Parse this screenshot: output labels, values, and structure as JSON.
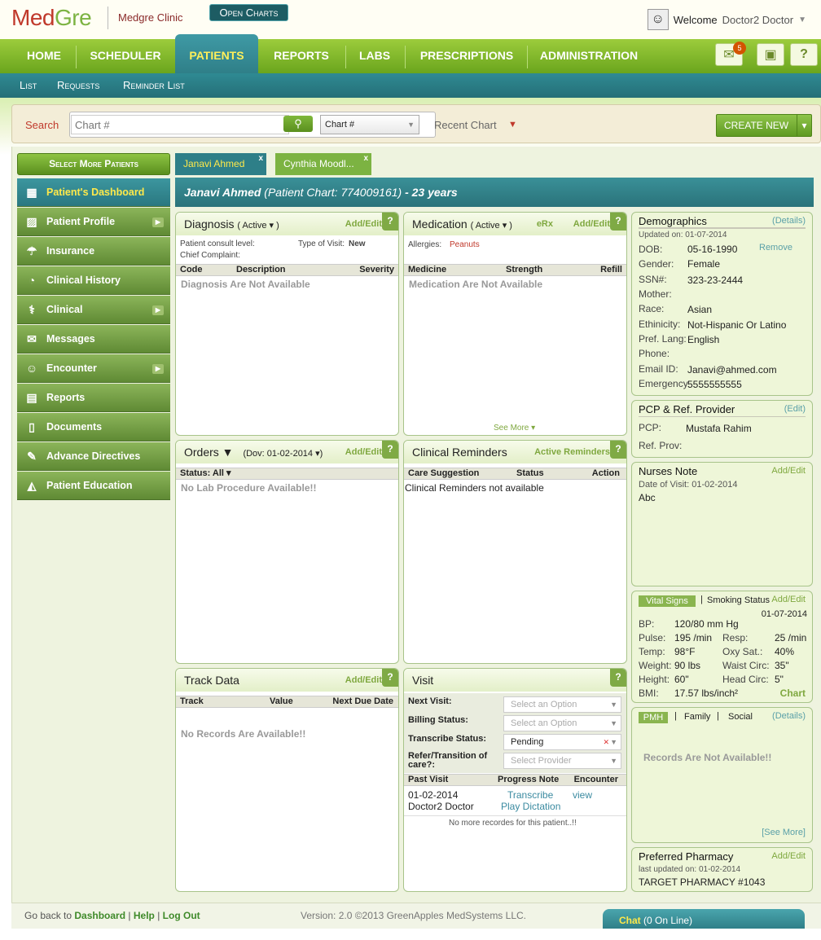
{
  "brand": {
    "logo_part1": "Med",
    "logo_part2": "Gre",
    "clinic": "Medgre Clinic"
  },
  "user": {
    "welcome": "Welcome",
    "name": "Doctor2 Doctor"
  },
  "nav": {
    "items": [
      "HOME",
      "SCHEDULER",
      "PATIENTS",
      "REPORTS",
      "LABS",
      "PRESCRIPTIONS",
      "ADMINISTRATION"
    ],
    "active": "PATIENTS",
    "mail_count": "5",
    "help": "?"
  },
  "subnav": {
    "items": [
      "List",
      "Requests",
      "Reminder List"
    ],
    "active": "Open Charts"
  },
  "search": {
    "label": "Search",
    "placeholder": "Chart #",
    "type": "Chart #",
    "recent": "Recent Chart",
    "create_new": "CREATE NEW"
  },
  "sidebar": {
    "select_more": "Select More Patients",
    "items": [
      "Patient's Dashboard",
      "Patient Profile",
      "Insurance",
      "Clinical History",
      "Clinical",
      "Messages",
      "Encounter",
      "Reports",
      "Documents",
      "Advance Directives",
      "Patient Education"
    ]
  },
  "tabs": [
    "Janavi Ahmed",
    "Cynthia Moodl..."
  ],
  "patient": {
    "name": "Janavi Ahmed",
    "chart": "(Patient Chart: 774009161)",
    "age": "- 23 years"
  },
  "diagnosis": {
    "title": "Diagnosis",
    "filter": "( Active ▾ )",
    "add_edit": "Add/Edit",
    "consult": "Patient consult level:",
    "visit_type_label": "Type of Visit:",
    "visit_type": "New",
    "complaint": "Chief Complaint:",
    "cols": [
      "Code",
      "Description",
      "Severity"
    ],
    "empty": "Diagnosis Are Not Available"
  },
  "medication": {
    "title": "Medication",
    "filter": "( Active ▾ )",
    "erx": "eRx",
    "add_edit": "Add/Edit",
    "allergies_label": "Allergies:",
    "allergies": "Peanuts",
    "cols": [
      "Medicine",
      "Strength",
      "Refill"
    ],
    "empty": "Medication Are Not Available",
    "see_more": "See More ▾"
  },
  "orders": {
    "title": "Orders ▼",
    "dov": "(Dov: 01-02-2014 ▾)",
    "add_edit": "Add/Edit",
    "status": "Status: All ▾",
    "empty": "No Lab Procedure Available!!"
  },
  "reminders": {
    "title": "Clinical Reminders",
    "link": "Active Reminders",
    "cols": [
      "Care Suggestion",
      "Status",
      "Action"
    ],
    "empty": "Clinical Reminders not available"
  },
  "track": {
    "title": "Track Data",
    "add_edit": "Add/Edit",
    "cols": [
      "Track",
      "Value",
      "Next Due Date"
    ],
    "empty": "No Records Are Available!!"
  },
  "visit": {
    "title": "Visit",
    "fields": [
      {
        "label": "Next Visit:",
        "value": "Select an Option"
      },
      {
        "label": "Billing Status:",
        "value": "Select an Option"
      },
      {
        "label": "Transcribe Status:",
        "value": "Pending"
      },
      {
        "label": "Refer/Transition of care?:",
        "value": "Select Provider"
      }
    ],
    "cols": [
      "Past Visit",
      "Progress Note",
      "Encounter"
    ],
    "row": {
      "date": "01-02-2014",
      "doctor": "Doctor2 Doctor",
      "note1": "Transcribe",
      "note2": "Play Dictation",
      "enc": "view"
    },
    "no_more": "No more recordes for this patient..!!"
  },
  "demographics": {
    "title": "Demographics",
    "details": "(Details)",
    "updated": "Updated on: 01-07-2014",
    "remove": "Remove",
    "rows": [
      {
        "k": "DOB:",
        "v": "05-16-1990"
      },
      {
        "k": "Gender:",
        "v": "Female"
      },
      {
        "k": "SSN#:",
        "v": "323-23-2444"
      },
      {
        "k": "Mother:",
        "v": ""
      },
      {
        "k": "Race:",
        "v": "Asian"
      },
      {
        "k": "Ethinicity:",
        "v": "Not-Hispanic Or Latino"
      },
      {
        "k": "Pref. Lang:",
        "v": "English"
      },
      {
        "k": "Phone:",
        "v": ""
      },
      {
        "k": "Email ID:",
        "v": "Janavi@ahmed.com"
      },
      {
        "k": "Emergency",
        "v": "5555555555"
      }
    ]
  },
  "pcp": {
    "title": "PCP & Ref. Provider",
    "edit": "(Edit)",
    "pcp_label": "PCP:",
    "pcp": "Mustafa Rahim",
    "ref_label": "Ref. Prov:"
  },
  "nurses": {
    "title": "Nurses Note",
    "add_edit": "Add/Edit",
    "date": "Date of Visit: 01-02-2014",
    "note": "Abc"
  },
  "vitals": {
    "tab1": "Vital Signs",
    "tab2": "Smoking Status",
    "add_edit": "Add/Edit",
    "date": "01-07-2014",
    "bp_k": "BP:",
    "bp": "120/80 mm Hg",
    "pulse_k": "Pulse:",
    "pulse": "195 /min",
    "resp_k": "Resp:",
    "resp": "25 /min",
    "temp_k": "Temp:",
    "temp": "98°F",
    "oxy_k": "Oxy Sat.:",
    "oxy": "40%",
    "weight_k": "Weight:",
    "weight": "90 lbs",
    "waist_k": "Waist Circ:",
    "waist": "35\"",
    "height_k": "Height:",
    "height": "60\"",
    "head_k": "Head Circ:",
    "head": "5\"",
    "bmi_k": "BMI:",
    "bmi": "17.57 lbs/inch²",
    "chart": "Chart"
  },
  "pmh": {
    "tab1": "PMH",
    "tab2": "Family",
    "tab3": "Social",
    "details": "(Details)",
    "empty": "Records Are Not Available!!",
    "see_more": "[See More]"
  },
  "pharmacy": {
    "title": "Preferred Pharmacy",
    "add_edit": "Add/Edit",
    "updated": "last updated on: 01-02-2014",
    "name": "TARGET PHARMACY #1043"
  },
  "footer": {
    "go_back": "Go back to",
    "dashboard": "Dashboard",
    "help": "Help",
    "logout": "Log Out",
    "version": "Version: 2.0 ©2013 GreenApples MedSystems LLC."
  },
  "chat": {
    "label": "Chat",
    "status": "(0 On Line)"
  }
}
